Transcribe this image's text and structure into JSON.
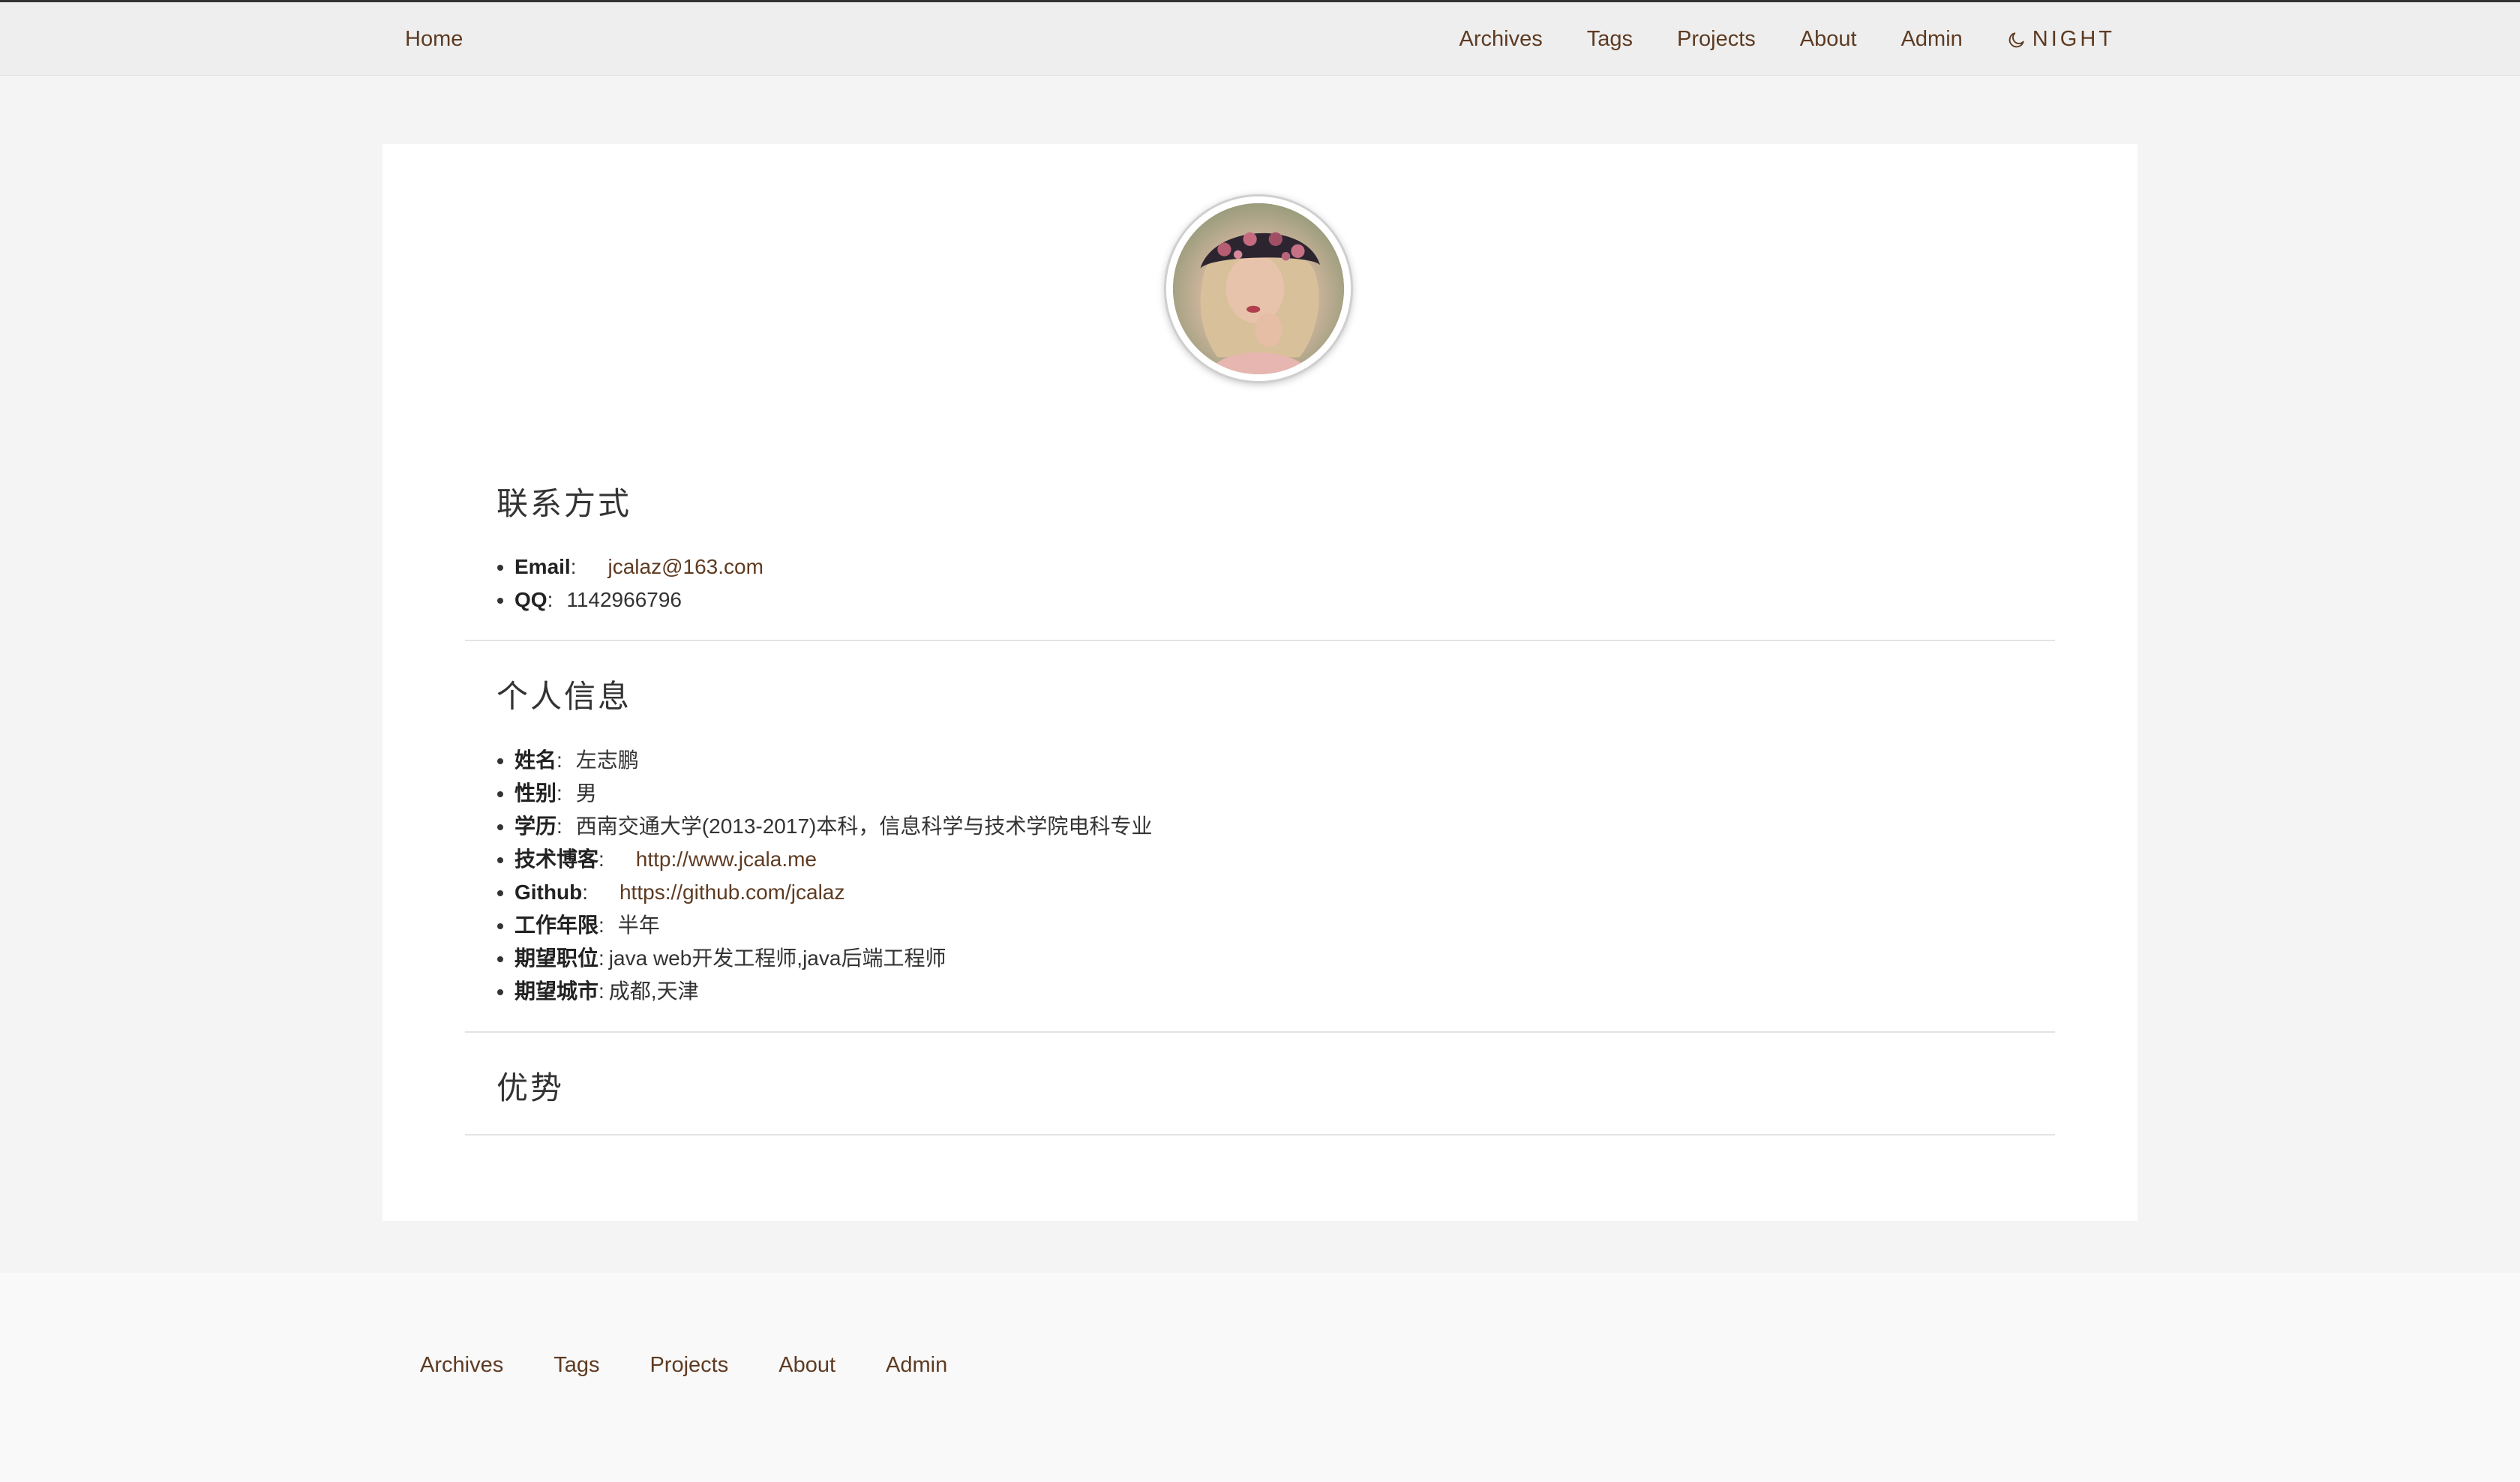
{
  "nav": {
    "home": "Home",
    "links": [
      "Archives",
      "Tags",
      "Projects",
      "About",
      "Admin"
    ],
    "night_label": "NIGHT",
    "night_icon": "moon-icon"
  },
  "sections": {
    "contact": {
      "title": "联系方式",
      "items": [
        {
          "key": "Email",
          "sep": ":",
          "value": "jcalaz@163.com"
        },
        {
          "key": "QQ",
          "sep": ":",
          "value": "1142966796"
        }
      ]
    },
    "personal": {
      "title": "个人信息",
      "items": [
        {
          "key": "姓名",
          "sep": ":",
          "value": "左志鹏"
        },
        {
          "key": "性别",
          "sep": ":",
          "value": "男"
        },
        {
          "key": "学历",
          "sep": ":",
          "value": "西南交通大学(2013-2017)本科，信息科学与技术学院电科专业"
        },
        {
          "key": "技术博客",
          "sep": ":",
          "value": "http://www.jcala.me"
        },
        {
          "key": "Github",
          "sep": ":",
          "value": "https://github.com/jcalaz"
        },
        {
          "key": "工作年限",
          "sep": ":",
          "value": "半年"
        },
        {
          "key": "期望职位",
          "sep": ":",
          "value": "java web开发工程师,java后端工程师"
        },
        {
          "key": "期望城市",
          "sep": ":",
          "value": "成都,天津"
        }
      ]
    },
    "strengths": {
      "title": "优势"
    }
  },
  "footer": {
    "links": [
      "Archives",
      "Tags",
      "Projects",
      "About",
      "Admin"
    ]
  },
  "colors": {
    "link": "#5e3b22",
    "text": "#333333",
    "page_bg": "#f4f4f4",
    "card_bg": "#ffffff"
  }
}
